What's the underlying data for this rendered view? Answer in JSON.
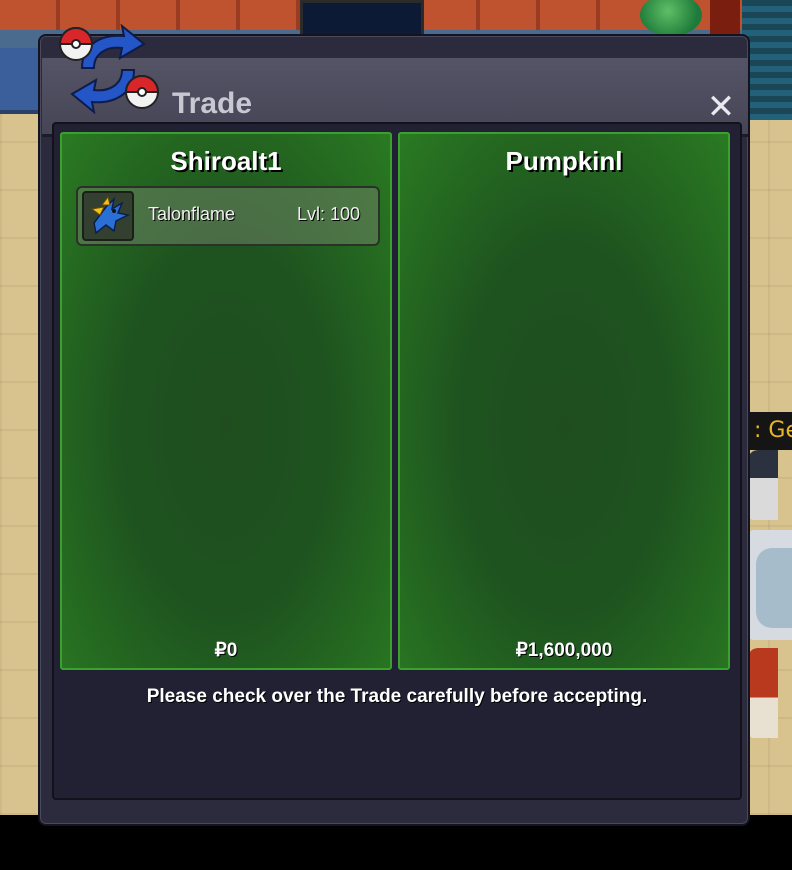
{
  "window": {
    "title": "Trade",
    "close_glyph": "✕"
  },
  "left_panel": {
    "player_name": "Shiroalt1",
    "pokemon": [
      {
        "name": "Talonflame",
        "level": "Lvl: 100",
        "icon": "talonflame-sprite-icon"
      }
    ],
    "money": "₽0"
  },
  "right_panel": {
    "player_name": "Pumpkinl",
    "pokemon": [],
    "money": "₽1,600,000"
  },
  "notice": "Please check over the Trade carefully before accepting.",
  "background": {
    "npc_label": ": Ge"
  },
  "colors": {
    "panel_green": "#1e531f",
    "panel_border": "#3aa12e",
    "window_bg": "#2c2a3d",
    "npc_label": "#e7b624"
  }
}
